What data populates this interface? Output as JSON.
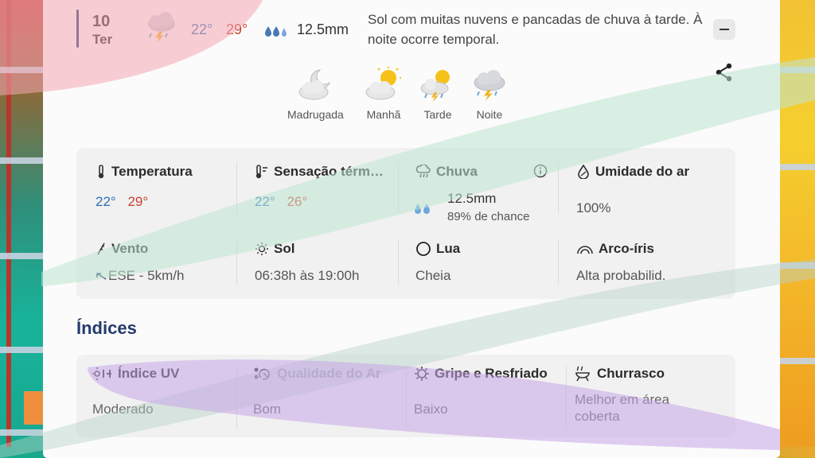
{
  "summary": {
    "day_number": "10",
    "day_name": "Ter",
    "temp_min": "22°",
    "temp_max": "29°",
    "rain": "12.5mm",
    "description": "Sol com muitas nuvens e pancadas de chuva à tarde. À noite ocorre temporal."
  },
  "periods": [
    {
      "label": "Madrugada",
      "icon": "moon-cloud-icon"
    },
    {
      "label": "Manhã",
      "icon": "sun-cloud-icon"
    },
    {
      "label": "Tarde",
      "icon": "sun-rain-cloud-icon"
    },
    {
      "label": "Noite",
      "icon": "storm-cloud-icon"
    }
  ],
  "details": {
    "temperature": {
      "title": "Temperatura",
      "min": "22°",
      "max": "29°"
    },
    "feels_like": {
      "title": "Sensação térm…",
      "min": "22°",
      "max": "26°"
    },
    "rain": {
      "title": "Chuva",
      "amount": "12.5mm",
      "chance": "89% de chance"
    },
    "humidity": {
      "title": "Umidade do ar",
      "value": "100%"
    },
    "wind": {
      "title": "Vento",
      "value": "ESE - 5km/h"
    },
    "sun": {
      "title": "Sol",
      "value": "06:38h às 19:00h"
    },
    "moon": {
      "title": "Lua",
      "value": "Cheia"
    },
    "rainbow": {
      "title": "Arco-íris",
      "value": "Alta probabilid."
    }
  },
  "indices": {
    "title": "Índices",
    "items": [
      {
        "title": "Índice UV",
        "value": "Moderado"
      },
      {
        "title": "Qualidade do Ar",
        "value": "Bom"
      },
      {
        "title": "Gripe e Resfriado",
        "value": "Baixo"
      },
      {
        "title": "Churrasco",
        "value": "Melhor em área coberta"
      }
    ]
  },
  "colors": {
    "min_temp": "#2c6fb7",
    "max_temp": "#c8402e",
    "title": "#243a6b"
  }
}
